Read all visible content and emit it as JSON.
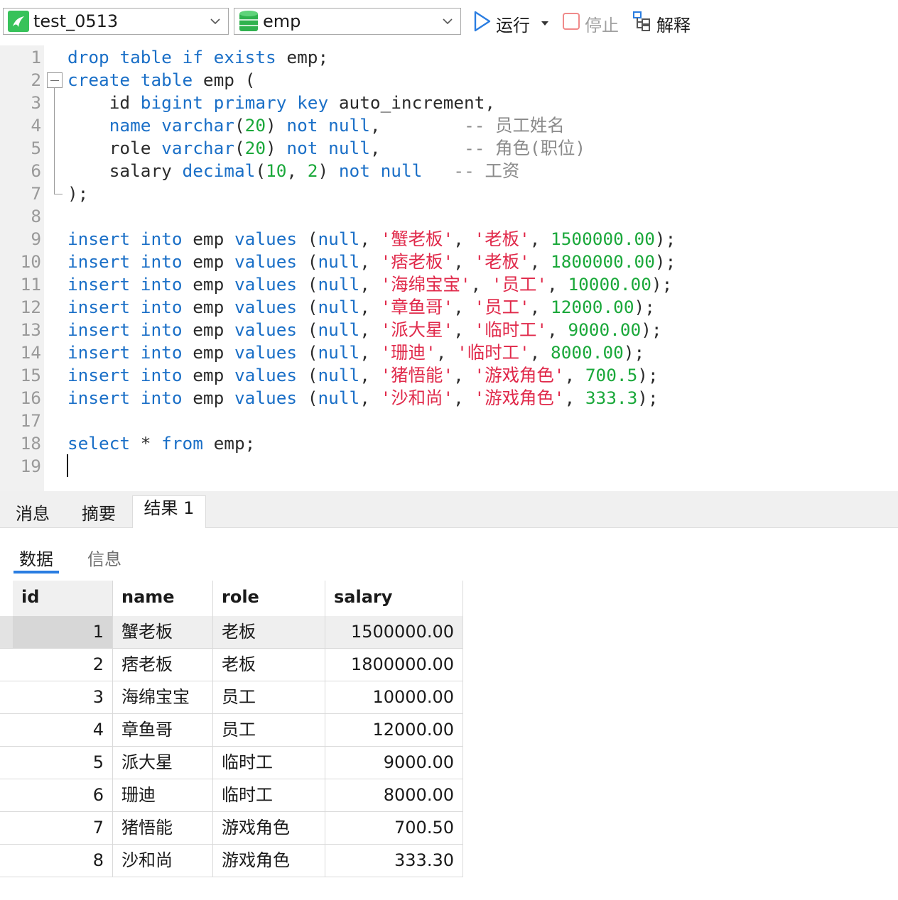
{
  "toolbar": {
    "connection": "test_0513",
    "database": "emp",
    "run_label": "运行",
    "stop_label": "停止",
    "explain_label": "解释"
  },
  "editor": {
    "lines": [
      {
        "n": "1",
        "tokens": [
          [
            "kw",
            "drop"
          ],
          [
            "p",
            " "
          ],
          [
            "kw",
            "table"
          ],
          [
            "p",
            " "
          ],
          [
            "kw",
            "if"
          ],
          [
            "p",
            " "
          ],
          [
            "kw",
            "exists"
          ],
          [
            "p",
            " emp;"
          ]
        ]
      },
      {
        "n": "2",
        "tokens": [
          [
            "kw",
            "create"
          ],
          [
            "p",
            " "
          ],
          [
            "kw",
            "table"
          ],
          [
            "p",
            " emp ("
          ]
        ]
      },
      {
        "n": "3",
        "tokens": [
          [
            "p",
            "    id "
          ],
          [
            "kw",
            "bigint"
          ],
          [
            "p",
            " "
          ],
          [
            "kw",
            "primary"
          ],
          [
            "p",
            " "
          ],
          [
            "kw",
            "key"
          ],
          [
            "p",
            " auto_increment,"
          ]
        ]
      },
      {
        "n": "4",
        "tokens": [
          [
            "p",
            "    "
          ],
          [
            "kw",
            "name"
          ],
          [
            "p",
            " "
          ],
          [
            "kw",
            "varchar"
          ],
          [
            "p",
            "("
          ],
          [
            "num",
            "20"
          ],
          [
            "p",
            ") "
          ],
          [
            "kw",
            "not"
          ],
          [
            "p",
            " "
          ],
          [
            "kw",
            "null"
          ],
          [
            "p",
            ",        "
          ],
          [
            "cm",
            "-- 员工姓名"
          ]
        ]
      },
      {
        "n": "5",
        "tokens": [
          [
            "p",
            "    role "
          ],
          [
            "kw",
            "varchar"
          ],
          [
            "p",
            "("
          ],
          [
            "num",
            "20"
          ],
          [
            "p",
            ") "
          ],
          [
            "kw",
            "not"
          ],
          [
            "p",
            " "
          ],
          [
            "kw",
            "null"
          ],
          [
            "p",
            ",        "
          ],
          [
            "cm",
            "-- 角色(职位)"
          ]
        ]
      },
      {
        "n": "6",
        "tokens": [
          [
            "p",
            "    salary "
          ],
          [
            "kw",
            "decimal"
          ],
          [
            "p",
            "("
          ],
          [
            "num",
            "10"
          ],
          [
            "p",
            ", "
          ],
          [
            "num",
            "2"
          ],
          [
            "p",
            ") "
          ],
          [
            "kw",
            "not"
          ],
          [
            "p",
            " "
          ],
          [
            "kw",
            "null"
          ],
          [
            "p",
            "   "
          ],
          [
            "cm",
            "-- 工资"
          ]
        ]
      },
      {
        "n": "7",
        "tokens": [
          [
            "p",
            ");"
          ]
        ]
      },
      {
        "n": "8",
        "tokens": []
      },
      {
        "n": "9",
        "tokens": [
          [
            "kw",
            "insert"
          ],
          [
            "p",
            " "
          ],
          [
            "kw",
            "into"
          ],
          [
            "p",
            " emp "
          ],
          [
            "kw",
            "values"
          ],
          [
            "p",
            " ("
          ],
          [
            "kw",
            "null"
          ],
          [
            "p",
            ", "
          ],
          [
            "str",
            "'蟹老板'"
          ],
          [
            "p",
            ", "
          ],
          [
            "str",
            "'老板'"
          ],
          [
            "p",
            ", "
          ],
          [
            "num",
            "1500000.00"
          ],
          [
            "p",
            ");"
          ]
        ]
      },
      {
        "n": "10",
        "tokens": [
          [
            "kw",
            "insert"
          ],
          [
            "p",
            " "
          ],
          [
            "kw",
            "into"
          ],
          [
            "p",
            " emp "
          ],
          [
            "kw",
            "values"
          ],
          [
            "p",
            " ("
          ],
          [
            "kw",
            "null"
          ],
          [
            "p",
            ", "
          ],
          [
            "str",
            "'痞老板'"
          ],
          [
            "p",
            ", "
          ],
          [
            "str",
            "'老板'"
          ],
          [
            "p",
            ", "
          ],
          [
            "num",
            "1800000.00"
          ],
          [
            "p",
            ");"
          ]
        ]
      },
      {
        "n": "11",
        "tokens": [
          [
            "kw",
            "insert"
          ],
          [
            "p",
            " "
          ],
          [
            "kw",
            "into"
          ],
          [
            "p",
            " emp "
          ],
          [
            "kw",
            "values"
          ],
          [
            "p",
            " ("
          ],
          [
            "kw",
            "null"
          ],
          [
            "p",
            ", "
          ],
          [
            "str",
            "'海绵宝宝'"
          ],
          [
            "p",
            ", "
          ],
          [
            "str",
            "'员工'"
          ],
          [
            "p",
            ", "
          ],
          [
            "num",
            "10000.00"
          ],
          [
            "p",
            ");"
          ]
        ]
      },
      {
        "n": "12",
        "tokens": [
          [
            "kw",
            "insert"
          ],
          [
            "p",
            " "
          ],
          [
            "kw",
            "into"
          ],
          [
            "p",
            " emp "
          ],
          [
            "kw",
            "values"
          ],
          [
            "p",
            " ("
          ],
          [
            "kw",
            "null"
          ],
          [
            "p",
            ", "
          ],
          [
            "str",
            "'章鱼哥'"
          ],
          [
            "p",
            ", "
          ],
          [
            "str",
            "'员工'"
          ],
          [
            "p",
            ", "
          ],
          [
            "num",
            "12000.00"
          ],
          [
            "p",
            ");"
          ]
        ]
      },
      {
        "n": "13",
        "tokens": [
          [
            "kw",
            "insert"
          ],
          [
            "p",
            " "
          ],
          [
            "kw",
            "into"
          ],
          [
            "p",
            " emp "
          ],
          [
            "kw",
            "values"
          ],
          [
            "p",
            " ("
          ],
          [
            "kw",
            "null"
          ],
          [
            "p",
            ", "
          ],
          [
            "str",
            "'派大星'"
          ],
          [
            "p",
            ", "
          ],
          [
            "str",
            "'临时工'"
          ],
          [
            "p",
            ", "
          ],
          [
            "num",
            "9000.00"
          ],
          [
            "p",
            ");"
          ]
        ]
      },
      {
        "n": "14",
        "tokens": [
          [
            "kw",
            "insert"
          ],
          [
            "p",
            " "
          ],
          [
            "kw",
            "into"
          ],
          [
            "p",
            " emp "
          ],
          [
            "kw",
            "values"
          ],
          [
            "p",
            " ("
          ],
          [
            "kw",
            "null"
          ],
          [
            "p",
            ", "
          ],
          [
            "str",
            "'珊迪'"
          ],
          [
            "p",
            ", "
          ],
          [
            "str",
            "'临时工'"
          ],
          [
            "p",
            ", "
          ],
          [
            "num",
            "8000.00"
          ],
          [
            "p",
            ");"
          ]
        ]
      },
      {
        "n": "15",
        "tokens": [
          [
            "kw",
            "insert"
          ],
          [
            "p",
            " "
          ],
          [
            "kw",
            "into"
          ],
          [
            "p",
            " emp "
          ],
          [
            "kw",
            "values"
          ],
          [
            "p",
            " ("
          ],
          [
            "kw",
            "null"
          ],
          [
            "p",
            ", "
          ],
          [
            "str",
            "'猪悟能'"
          ],
          [
            "p",
            ", "
          ],
          [
            "str",
            "'游戏角色'"
          ],
          [
            "p",
            ", "
          ],
          [
            "num",
            "700.5"
          ],
          [
            "p",
            ");"
          ]
        ]
      },
      {
        "n": "16",
        "tokens": [
          [
            "kw",
            "insert"
          ],
          [
            "p",
            " "
          ],
          [
            "kw",
            "into"
          ],
          [
            "p",
            " emp "
          ],
          [
            "kw",
            "values"
          ],
          [
            "p",
            " ("
          ],
          [
            "kw",
            "null"
          ],
          [
            "p",
            ", "
          ],
          [
            "str",
            "'沙和尚'"
          ],
          [
            "p",
            ", "
          ],
          [
            "str",
            "'游戏角色'"
          ],
          [
            "p",
            ", "
          ],
          [
            "num",
            "333.3"
          ],
          [
            "p",
            ");"
          ]
        ]
      },
      {
        "n": "17",
        "tokens": []
      },
      {
        "n": "18",
        "tokens": [
          [
            "kw",
            "select"
          ],
          [
            "p",
            " * "
          ],
          [
            "kw",
            "from"
          ],
          [
            "p",
            " emp;"
          ]
        ]
      },
      {
        "n": "19",
        "tokens": []
      }
    ]
  },
  "result_tabs": [
    "消息",
    "摘要",
    "结果 1"
  ],
  "active_result_tab": "结果 1",
  "sub_tabs": [
    "数据",
    "信息"
  ],
  "active_sub_tab": "数据",
  "grid": {
    "columns": [
      "id",
      "name",
      "role",
      "salary"
    ],
    "rows": [
      [
        "1",
        "蟹老板",
        "老板",
        "1500000.00"
      ],
      [
        "2",
        "痞老板",
        "老板",
        "1800000.00"
      ],
      [
        "3",
        "海绵宝宝",
        "员工",
        "10000.00"
      ],
      [
        "4",
        "章鱼哥",
        "员工",
        "12000.00"
      ],
      [
        "5",
        "派大星",
        "临时工",
        "9000.00"
      ],
      [
        "6",
        "珊迪",
        "临时工",
        "8000.00"
      ],
      [
        "7",
        "猪悟能",
        "游戏角色",
        "700.50"
      ],
      [
        "8",
        "沙和尚",
        "游戏角色",
        "333.30"
      ]
    ],
    "selected_row": 0
  },
  "colors": {
    "keyword": "#1a6fc7",
    "string": "#e0294a",
    "number": "#1aa83a",
    "comment": "#8a8a8a",
    "accent": "#2a7de1"
  },
  "icons": {
    "connection": "connection-icon",
    "database": "database-icon",
    "run": "play-icon",
    "stop": "stop-icon",
    "explain": "explain-icon"
  }
}
